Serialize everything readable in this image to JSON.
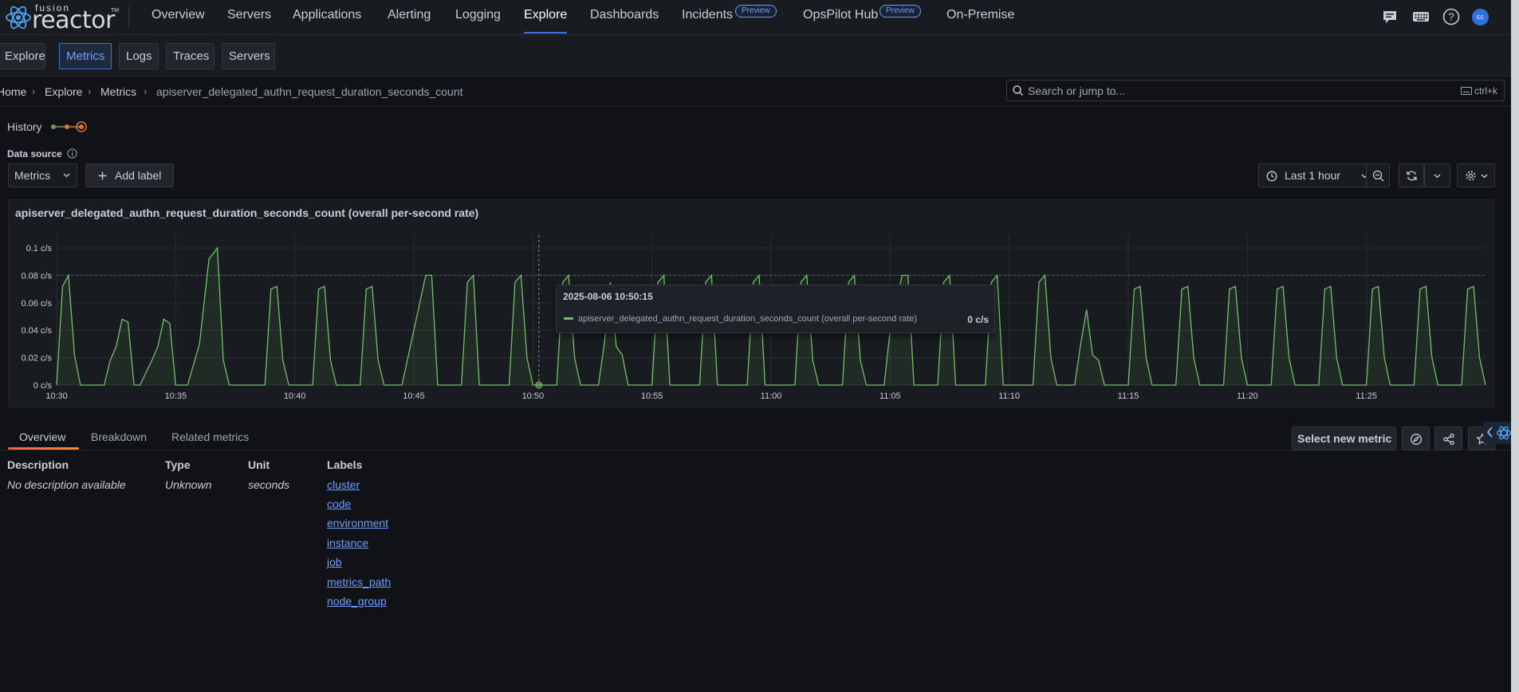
{
  "brand": {
    "top": "fusion",
    "main": "reactor",
    "tm": "TM"
  },
  "nav": {
    "items": [
      {
        "label": "Overview"
      },
      {
        "label": "Servers"
      },
      {
        "label": "Applications"
      },
      {
        "label": "Alerting"
      },
      {
        "label": "Logging"
      },
      {
        "label": "Explore"
      },
      {
        "label": "Dashboards"
      },
      {
        "label": "Incidents"
      },
      {
        "label": "OpsPilot Hub"
      },
      {
        "label": "On-Premise"
      }
    ],
    "active": "Explore",
    "badge_incidents": "Preview",
    "badge_opspilot": "Preview",
    "avatar_initials": "cc",
    "icons": [
      "chat-icon",
      "keyboard-icon",
      "help-icon",
      "avatar"
    ]
  },
  "subtabs": [
    "Explore",
    "Metrics",
    "Logs",
    "Traces",
    "Servers"
  ],
  "subtab_active": "Metrics",
  "breadcrumb": [
    "Home",
    "Explore",
    "Metrics",
    "apiserver_delegated_authn_request_duration_seconds_count"
  ],
  "search": {
    "placeholder": "Search or jump to...",
    "shortcut": "ctrl+k"
  },
  "history_label": "History",
  "datasource": {
    "label": "Data source",
    "value": "Metrics"
  },
  "add_label": "Add label",
  "time_range": "Last 1 hour",
  "panel": {
    "title": "apiserver_delegated_authn_request_duration_seconds_count (overall per-second rate)"
  },
  "chart_data": {
    "type": "area",
    "title": "apiserver_delegated_authn_request_duration_seconds_count (overall per-second rate)",
    "y_unit": "c/s",
    "yticks": [
      "0 c/s",
      "0.02 c/s",
      "0.04 c/s",
      "0.06 c/s",
      "0.08 c/s",
      "0.1 c/s"
    ],
    "ylim": [
      0,
      0.1
    ],
    "xticks": [
      "10:30",
      "10:35",
      "10:40",
      "10:45",
      "10:50",
      "10:55",
      "11:00",
      "11:05",
      "11:10",
      "11:15",
      "11:20",
      "11:25"
    ],
    "x_minutes_range": [
      0,
      60
    ],
    "grid": true,
    "series": [
      {
        "name": "apiserver_delegated_authn_request_duration_seconds_count (overall per-second rate)",
        "color": "#73bf69",
        "points": [
          [
            0,
            0
          ],
          [
            0.25,
            0.072
          ],
          [
            0.5,
            0.08
          ],
          [
            0.75,
            0.022
          ],
          [
            1.0,
            0
          ],
          [
            1.5,
            0
          ],
          [
            2.0,
            0
          ],
          [
            2.25,
            0.018
          ],
          [
            2.5,
            0.028
          ],
          [
            2.75,
            0.048
          ],
          [
            3.0,
            0.046
          ],
          [
            3.25,
            0
          ],
          [
            3.5,
            0
          ],
          [
            4.0,
            0.018
          ],
          [
            4.25,
            0.028
          ],
          [
            4.5,
            0.048
          ],
          [
            4.75,
            0.045
          ],
          [
            5.0,
            0
          ],
          [
            5.5,
            0
          ],
          [
            6.0,
            0.03
          ],
          [
            6.4,
            0.092
          ],
          [
            6.75,
            0.1
          ],
          [
            7.0,
            0.018
          ],
          [
            7.25,
            0
          ],
          [
            8.0,
            0
          ],
          [
            8.75,
            0
          ],
          [
            9.0,
            0.07
          ],
          [
            9.25,
            0.072
          ],
          [
            9.5,
            0.018
          ],
          [
            9.75,
            0
          ],
          [
            10.5,
            0
          ],
          [
            10.75,
            0
          ],
          [
            11.0,
            0.07
          ],
          [
            11.25,
            0.072
          ],
          [
            11.5,
            0.018
          ],
          [
            11.75,
            0
          ],
          [
            12.5,
            0
          ],
          [
            12.75,
            0
          ],
          [
            13.0,
            0.07
          ],
          [
            13.25,
            0.072
          ],
          [
            13.5,
            0.018
          ],
          [
            13.75,
            0
          ],
          [
            14.5,
            0
          ],
          [
            15.0,
            0.04
          ],
          [
            15.5,
            0.08
          ],
          [
            15.75,
            0.08
          ],
          [
            16.0,
            0
          ],
          [
            16.75,
            0
          ],
          [
            17.0,
            0
          ],
          [
            17.25,
            0.075
          ],
          [
            17.5,
            0.08
          ],
          [
            17.75,
            0
          ],
          [
            18.75,
            0
          ],
          [
            19.0,
            0
          ],
          [
            19.25,
            0.075
          ],
          [
            19.5,
            0.08
          ],
          [
            19.75,
            0.02
          ],
          [
            20.0,
            0
          ],
          [
            20.3,
            0
          ],
          [
            21.0,
            0
          ],
          [
            21.25,
            0.075
          ],
          [
            21.5,
            0.08
          ],
          [
            21.75,
            0.02
          ],
          [
            22.0,
            0
          ],
          [
            22.75,
            0
          ],
          [
            23.0,
            0.03
          ],
          [
            23.25,
            0.075
          ],
          [
            23.5,
            0.028
          ],
          [
            23.75,
            0.022
          ],
          [
            24.0,
            0
          ],
          [
            24.75,
            0
          ],
          [
            25.0,
            0
          ],
          [
            25.25,
            0.075
          ],
          [
            25.5,
            0.08
          ],
          [
            25.75,
            0
          ],
          [
            26.75,
            0
          ],
          [
            27.0,
            0
          ],
          [
            27.25,
            0.075
          ],
          [
            27.5,
            0.08
          ],
          [
            27.75,
            0
          ],
          [
            28.75,
            0
          ],
          [
            29.0,
            0
          ],
          [
            29.25,
            0.075
          ],
          [
            29.5,
            0.08
          ],
          [
            29.75,
            0
          ],
          [
            30.75,
            0
          ],
          [
            31.0,
            0
          ],
          [
            31.25,
            0.075
          ],
          [
            31.5,
            0.08
          ],
          [
            31.75,
            0.018
          ],
          [
            32.0,
            0
          ],
          [
            32.75,
            0
          ],
          [
            33.0,
            0
          ],
          [
            33.25,
            0.075
          ],
          [
            33.5,
            0.08
          ],
          [
            33.75,
            0.018
          ],
          [
            34.0,
            0
          ],
          [
            34.75,
            0
          ],
          [
            35.0,
            0.04
          ],
          [
            35.5,
            0.08
          ],
          [
            35.75,
            0.08
          ],
          [
            36.0,
            0
          ],
          [
            36.75,
            0
          ],
          [
            37.0,
            0
          ],
          [
            37.25,
            0.075
          ],
          [
            37.5,
            0.08
          ],
          [
            37.75,
            0
          ],
          [
            38.75,
            0
          ],
          [
            39.0,
            0
          ],
          [
            39.25,
            0.075
          ],
          [
            39.5,
            0.08
          ],
          [
            39.75,
            0
          ],
          [
            40.75,
            0
          ],
          [
            41.0,
            0
          ],
          [
            41.25,
            0.075
          ],
          [
            41.5,
            0.08
          ],
          [
            41.75,
            0.02
          ],
          [
            42.0,
            0
          ],
          [
            42.75,
            0
          ],
          [
            43.0,
            0.03
          ],
          [
            43.25,
            0.055
          ],
          [
            43.5,
            0.022
          ],
          [
            43.75,
            0.018
          ],
          [
            44.0,
            0
          ],
          [
            44.75,
            0
          ],
          [
            45.0,
            0
          ],
          [
            45.25,
            0.07
          ],
          [
            45.5,
            0.072
          ],
          [
            45.75,
            0.02
          ],
          [
            46.0,
            0
          ],
          [
            46.75,
            0
          ],
          [
            47.0,
            0
          ],
          [
            47.25,
            0.07
          ],
          [
            47.5,
            0.072
          ],
          [
            47.75,
            0.02
          ],
          [
            48.0,
            0
          ],
          [
            48.75,
            0
          ],
          [
            49.0,
            0
          ],
          [
            49.25,
            0.07
          ],
          [
            49.5,
            0.072
          ],
          [
            49.75,
            0.02
          ],
          [
            50.0,
            0
          ],
          [
            50.75,
            0
          ],
          [
            51.0,
            0
          ],
          [
            51.25,
            0.07
          ],
          [
            51.5,
            0.072
          ],
          [
            51.75,
            0.02
          ],
          [
            52.0,
            0
          ],
          [
            52.75,
            0
          ],
          [
            53.0,
            0
          ],
          [
            53.25,
            0.07
          ],
          [
            53.5,
            0.072
          ],
          [
            53.75,
            0.02
          ],
          [
            54.0,
            0
          ],
          [
            54.75,
            0
          ],
          [
            55.0,
            0
          ],
          [
            55.25,
            0.07
          ],
          [
            55.5,
            0.072
          ],
          [
            55.75,
            0.02
          ],
          [
            56.0,
            0
          ],
          [
            56.75,
            0
          ],
          [
            57.0,
            0
          ],
          [
            57.25,
            0.07
          ],
          [
            57.5,
            0.072
          ],
          [
            57.75,
            0.02
          ],
          [
            58.0,
            0
          ],
          [
            58.75,
            0
          ],
          [
            59.0,
            0
          ],
          [
            59.25,
            0.07
          ],
          [
            59.5,
            0.072
          ],
          [
            59.75,
            0.02
          ],
          [
            60.0,
            0
          ]
        ]
      }
    ],
    "tooltip": {
      "time": "2025-08-06 10:50:15",
      "series": "apiserver_delegated_authn_request_duration_seconds_count (overall per-second rate)",
      "value": "0 c/s",
      "x_minute": 20.25
    },
    "threshold_dashed": 0.08
  },
  "bottom_tabs": [
    "Overview",
    "Breakdown",
    "Related metrics"
  ],
  "bottom_tab_active": "Overview",
  "select_new_metric": "Select new metric",
  "info": {
    "description_label": "Description",
    "description_value": "No description available",
    "type_label": "Type",
    "type_value": "Unknown",
    "unit_label": "Unit",
    "unit_value": "seconds",
    "labels_label": "Labels",
    "labels": [
      "cluster",
      "code",
      "environment",
      "instance",
      "job",
      "metrics_path",
      "node_group"
    ]
  }
}
